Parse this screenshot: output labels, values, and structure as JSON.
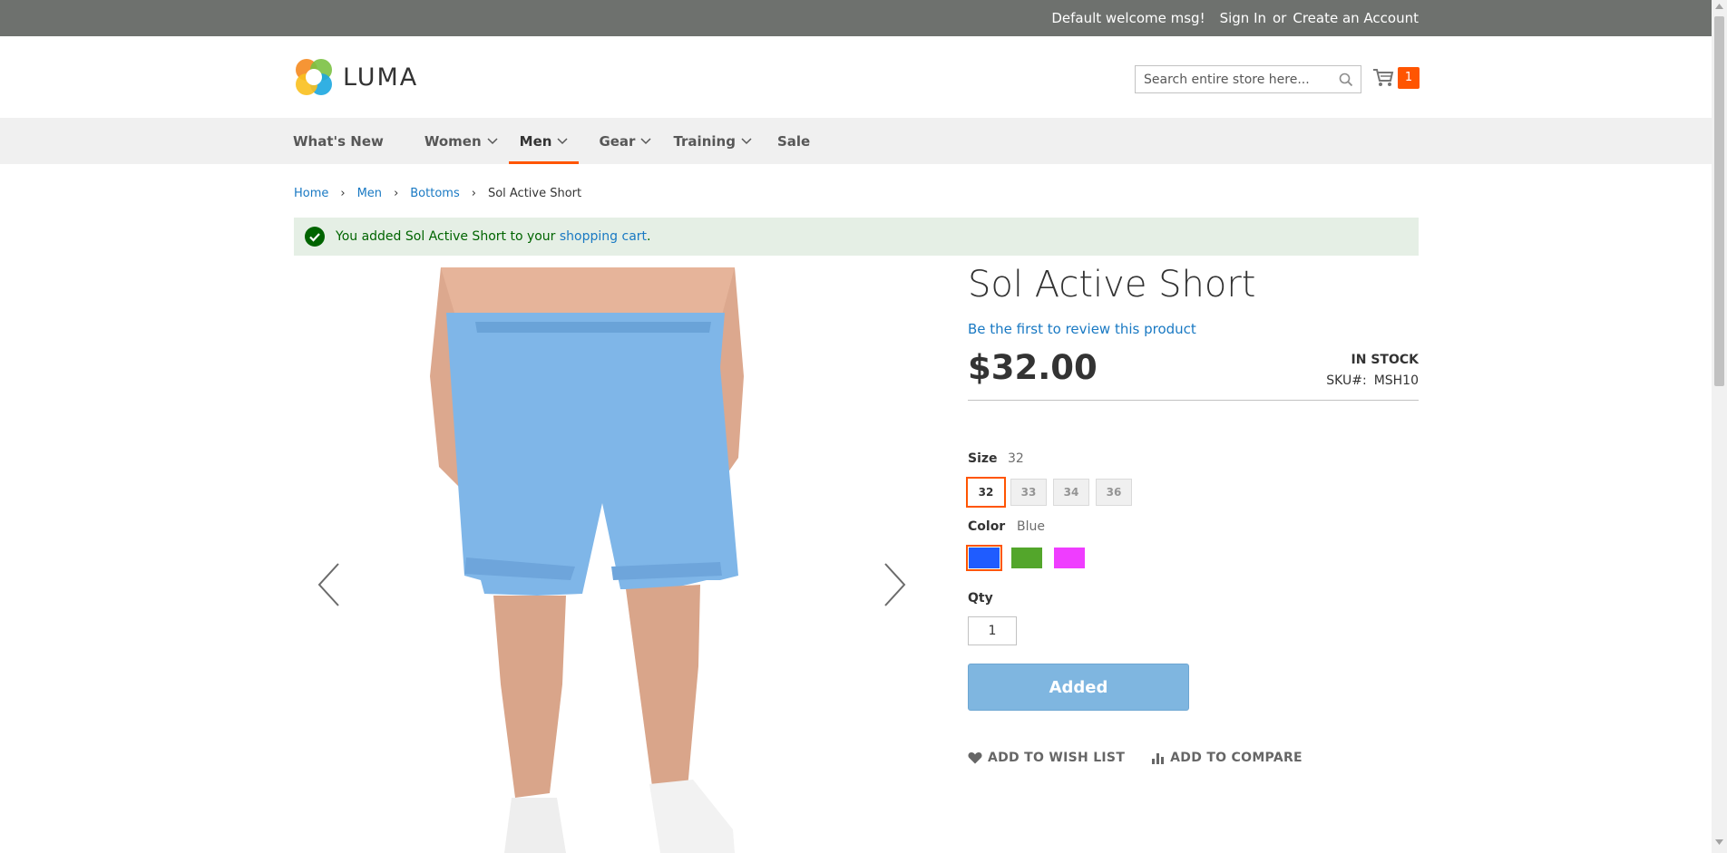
{
  "top_panel": {
    "welcome": "Default welcome msg!",
    "sign_in": "Sign In",
    "or": "or",
    "create_account": "Create an Account"
  },
  "header": {
    "logo_text": "LUMA",
    "search_placeholder": "Search entire store here...",
    "cart_count": "1"
  },
  "nav": {
    "items": [
      {
        "label": "What's New"
      },
      {
        "label": "Women"
      },
      {
        "label": "Men"
      },
      {
        "label": "Gear"
      },
      {
        "label": "Training"
      },
      {
        "label": "Sale"
      }
    ],
    "active": "Men"
  },
  "breadcrumb": {
    "items": [
      "Home",
      "Men",
      "Bottoms"
    ],
    "current": "Sol Active Short"
  },
  "message": {
    "prefix": "You added Sol Active Short to your ",
    "link": "shopping cart",
    "suffix": "."
  },
  "product": {
    "title": "Sol Active Short",
    "review_link": "Be the first to review this product",
    "price": "$32.00",
    "stock": "IN STOCK",
    "sku_label": "SKU#:",
    "sku": "MSH10",
    "size_label": "Size",
    "size_selected": "32",
    "sizes": [
      "32",
      "33",
      "34",
      "36"
    ],
    "color_label": "Color",
    "color_selected": "Blue",
    "colors": [
      "#1f5cff",
      "#53a62b",
      "#ef3dff"
    ],
    "qty_label": "Qty",
    "qty_value": "1",
    "add_button": "Added",
    "wishlist": "ADD TO WISH LIST",
    "compare": "ADD TO COMPARE"
  }
}
